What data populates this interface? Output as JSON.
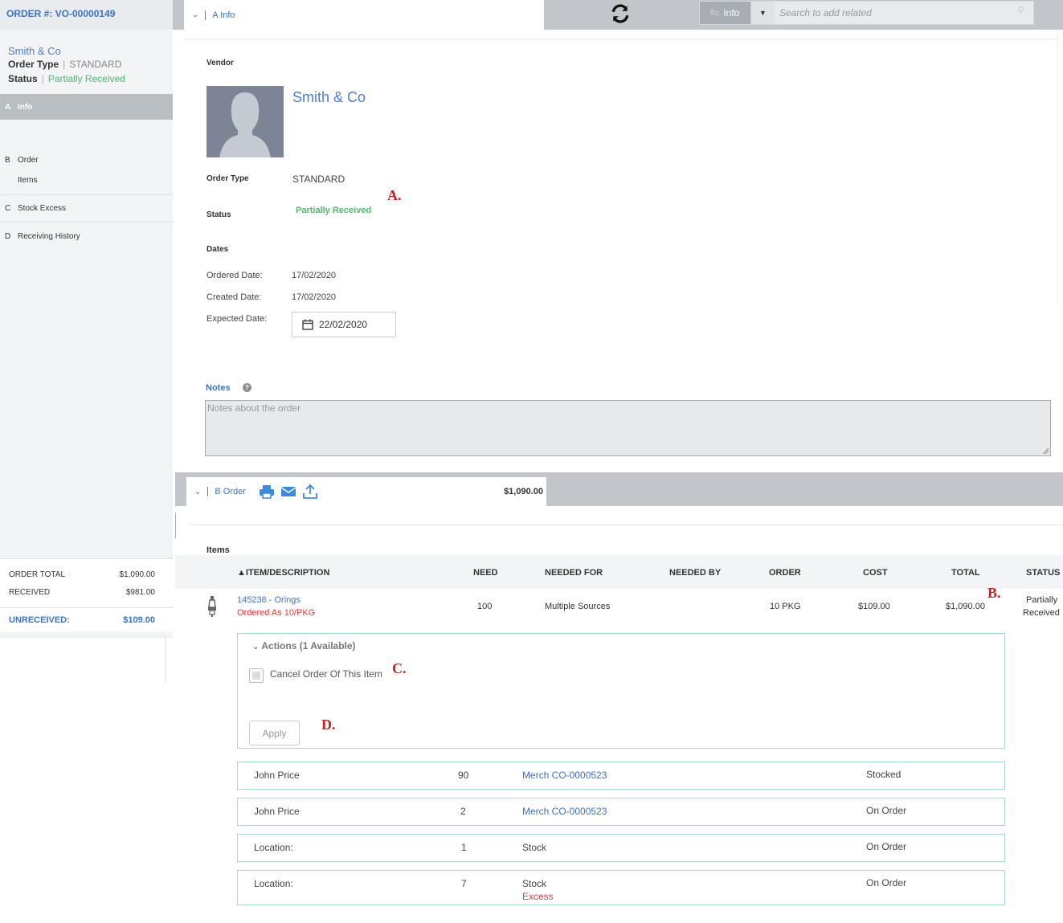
{
  "sidebar": {
    "order_number": "ORDER #: VO-00000149",
    "vendor": "Smith & Co",
    "order_type_label": "Order Type",
    "order_type_value": "STANDARD",
    "status_label": "Status",
    "status_value": "Partially Received",
    "nav": [
      {
        "letter": "A",
        "label": "Info",
        "active": true
      },
      {
        "letter": "B",
        "label": "Order",
        "sub": "Items"
      },
      {
        "letter": "C",
        "label": "Stock Excess"
      },
      {
        "letter": "D",
        "label": "Receiving History"
      }
    ],
    "totals": {
      "order_total_label": "ORDER TOTAL",
      "order_total": "$1,090.00",
      "received_label": "RECEIVED",
      "received": "$981.00",
      "unreceived_label": "UNRECEIVED:",
      "unreceived": "$109.00"
    }
  },
  "topbar": {
    "tab_label": "A Info",
    "to_prefix": "To:",
    "to_value": "Info",
    "search_placeholder": "Search to add related"
  },
  "info": {
    "vendor_label": "Vendor",
    "vendor_name": "Smith & Co",
    "order_type_label": "Order Type",
    "order_type_value": "STANDARD",
    "status_label": "Status",
    "status_value": "Partially Received",
    "dates_label": "Dates",
    "ordered_date_label": "Ordered Date:",
    "ordered_date": "17/02/2020",
    "created_date_label": "Created Date:",
    "created_date": "17/02/2020",
    "expected_date_label": "Expected Date:",
    "expected_date": "22/02/2020",
    "notes_label": "Notes",
    "notes_placeholder": "Notes about the order"
  },
  "annotations": {
    "a": "A.",
    "b": "B.",
    "c": "C.",
    "d": "D."
  },
  "order": {
    "tab_label": "B Order",
    "total": "$1,090.00",
    "items_label": "Items",
    "columns": [
      "ITEM/DESCRIPTION",
      "NEED",
      "NEEDED FOR",
      "NEEDED BY",
      "ORDER",
      "COST",
      "TOTAL",
      "STATUS"
    ],
    "item": {
      "code": "145236 - Orings",
      "ordered_as": "Ordered As 10/PKG",
      "need": "100",
      "needed_for": "Multiple Sources",
      "order": "10 PKG",
      "cost": "$109.00",
      "total": "$1,090.00",
      "status_line1": "Partially",
      "status_line2": "Received"
    },
    "actions": {
      "title": "Actions (1 Available)",
      "cancel_label": "Cancel Order Of This Item",
      "apply_label": "Apply"
    },
    "sources": [
      {
        "name": "John Price",
        "qty": "90",
        "ref": "Merch CO-0000523",
        "status": "Stocked"
      },
      {
        "name": "John Price",
        "qty": "2",
        "ref": "Merch CO-0000523",
        "status": "On Order"
      },
      {
        "name": "Location:",
        "qty": "1",
        "ref": "Stock",
        "status": "On Order"
      },
      {
        "name": "Location:",
        "qty": "7",
        "ref": "Stock",
        "ref2": "Excess",
        "status": "On Order"
      }
    ]
  },
  "colors": {
    "accent": "#3b73c8",
    "green": "#4dbb6d",
    "red": "#e23a3a",
    "annotation": "#cc1f1f"
  }
}
